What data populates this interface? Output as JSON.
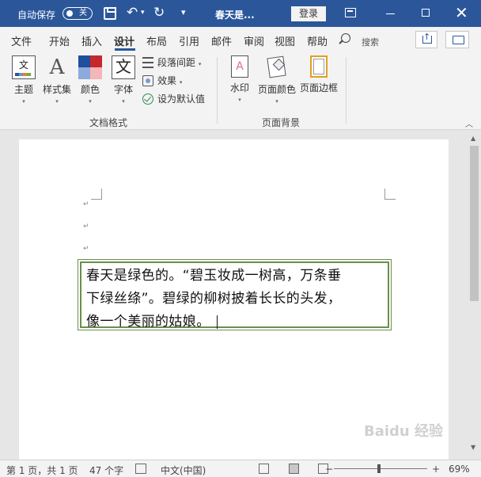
{
  "titlebar": {
    "autosave_label": "自动保存",
    "autosave_state": "关",
    "undo_glyph": "↶",
    "undo_caret": "▾",
    "redo_glyph": "↻",
    "qat_more": "▾",
    "doc_title": "春天是...",
    "login_label": "登录",
    "close_glyph": "✕"
  },
  "tabs": [
    "文件",
    "开始",
    "插入",
    "设计",
    "布局",
    "引用",
    "邮件",
    "审阅",
    "视图",
    "帮助"
  ],
  "active_tab": "设计",
  "search_label": "搜索",
  "ribbon": {
    "doc_format": {
      "theme": {
        "label": "主题",
        "icon_text": "文"
      },
      "styles": {
        "label": "样式集",
        "icon_text": "A"
      },
      "colors": {
        "label": "颜色"
      },
      "fonts": {
        "label": "字体",
        "icon_text": "文"
      },
      "paragraph_spacing": "段落间距",
      "effects": "效果",
      "set_default": "设为默认值",
      "group_label": "文档格式"
    },
    "page_background": {
      "watermark": {
        "label": "水印",
        "icon_text": "A"
      },
      "page_color": {
        "label": "页面颜色"
      },
      "page_borders": {
        "label": "页面边框"
      },
      "group_label": "页面背景"
    },
    "caret": "▾",
    "collapse": "︿"
  },
  "document": {
    "paragraph_marks": [
      "↵",
      "↵",
      "↵"
    ],
    "textbox_lines": [
      "春天是绿色的。“碧玉妆成一树高，万条垂",
      "下绿丝绦”。碧绿的柳树披着长长的头发，",
      "像一个美丽的姑娘。"
    ]
  },
  "scroll": {
    "up": "▲",
    "down": "▼"
  },
  "watermark_text": "Baidu 经验",
  "statusbar": {
    "page_info": "第 1 页，共 1 页",
    "word_count": "47 个字",
    "language": "中文(中国)",
    "zoom_minus": "−",
    "zoom_plus": "+",
    "zoom_level": "69%"
  }
}
